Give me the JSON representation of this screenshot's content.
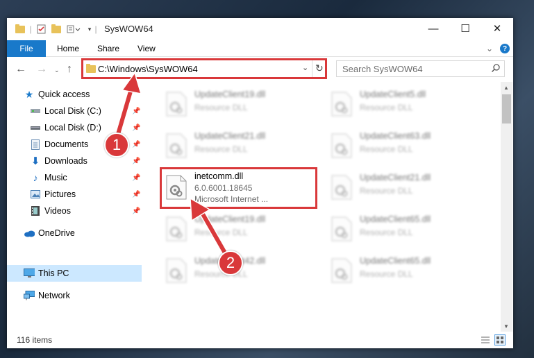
{
  "window": {
    "title": "SysWOW64",
    "minimize": "—",
    "maximize": "☐",
    "close": "✕"
  },
  "ribbon": {
    "tabs": [
      "File",
      "Home",
      "Share",
      "View"
    ],
    "help": "?",
    "expand": "⌄"
  },
  "nav": {
    "address": "C:\\Windows\\SysWOW64",
    "search_placeholder": "Search SysWOW64"
  },
  "sidebar": {
    "items": [
      {
        "label": "Quick access",
        "icon": "star-icon",
        "pinned": false
      },
      {
        "label": "Local Disk (C:)",
        "icon": "drive-icon",
        "pinned": true
      },
      {
        "label": "Local Disk (D:)",
        "icon": "drive-icon",
        "pinned": true
      },
      {
        "label": "Documents",
        "icon": "documents-icon",
        "pinned": true
      },
      {
        "label": "Downloads",
        "icon": "download-icon",
        "pinned": true
      },
      {
        "label": "Music",
        "icon": "music-icon",
        "pinned": true
      },
      {
        "label": "Pictures",
        "icon": "pictures-icon",
        "pinned": true
      },
      {
        "label": "Videos",
        "icon": "videos-icon",
        "pinned": true
      },
      {
        "label": "OneDrive",
        "icon": "cloud-icon",
        "pinned": false
      },
      {
        "label": "This PC",
        "icon": "computer-icon",
        "pinned": false,
        "selected": true
      },
      {
        "label": "Network",
        "icon": "network-icon",
        "pinned": false
      }
    ]
  },
  "files": [
    {
      "name": "UpdateClient19.dll",
      "sub": "Resource DLL",
      "blurred": true
    },
    {
      "name": "UpdateClient5.dll",
      "sub": "Resource DLL",
      "blurred": true
    },
    {
      "name": "UpdateClient21.dll",
      "sub": "Resource DLL",
      "blurred": true
    },
    {
      "name": "UpdateClient63.dll",
      "sub": "Resource DLL",
      "blurred": true
    },
    {
      "name": "inetcomm.dll",
      "sub": "6.0.6001.18645",
      "sub2": "Microsoft Internet ...",
      "blurred": false
    },
    {
      "name": "UpdateClient21.dll",
      "sub": "Resource DLL",
      "blurred": true
    },
    {
      "name": "UpdateClient19.dll",
      "sub": "Resource DLL",
      "blurred": true
    },
    {
      "name": "UpdateClient65.dll",
      "sub": "Resource DLL",
      "blurred": true
    },
    {
      "name": "UpdateClient42.dll",
      "sub": "Resource DLL",
      "blurred": true
    },
    {
      "name": "UpdateClient65.dll",
      "sub": "Resource DLL",
      "blurred": true
    }
  ],
  "status": {
    "count": "116 items"
  },
  "annotations": {
    "badge1": "1",
    "badge2": "2",
    "color": "#d9383a"
  }
}
